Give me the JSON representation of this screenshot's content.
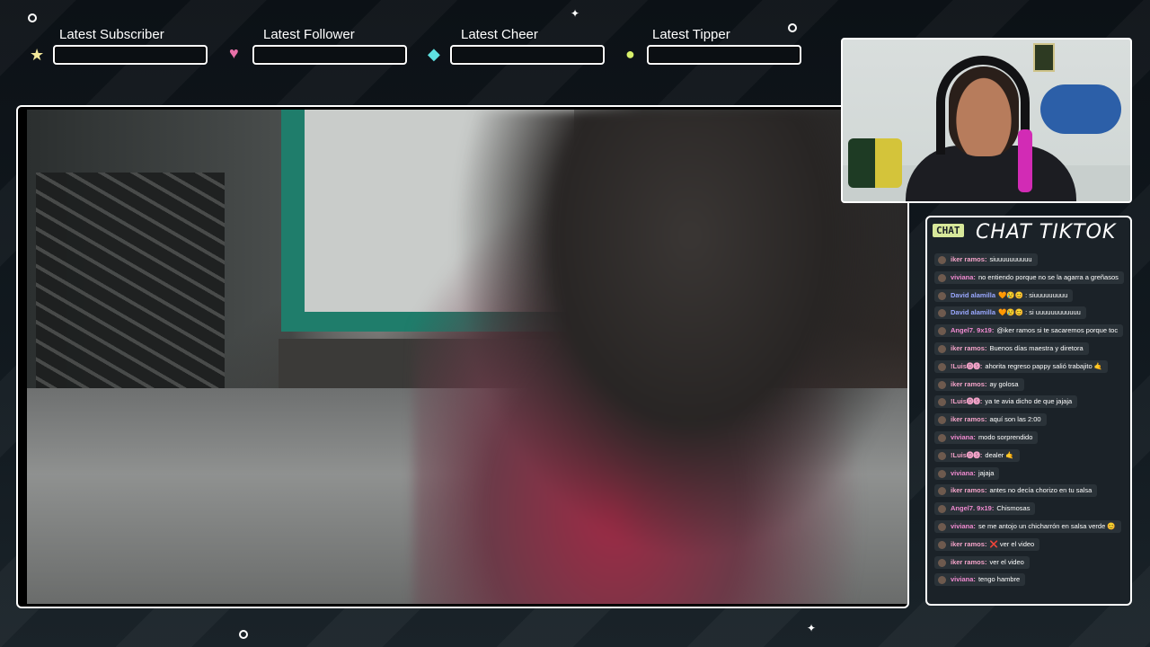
{
  "alerts": [
    {
      "title": "Latest Subscriber",
      "icon": "★",
      "icon_name": "star-icon",
      "color": "#f3e89a"
    },
    {
      "title": "Latest Follower",
      "icon": "♥",
      "icon_name": "heart-icon",
      "color": "#e870a8"
    },
    {
      "title": "Latest Cheer",
      "icon": "◆",
      "icon_name": "gem-icon",
      "color": "#5fe0e0"
    },
    {
      "title": "Latest Tipper",
      "icon": "●",
      "icon_name": "coin-icon",
      "color": "#d7ef6a"
    }
  ],
  "chat": {
    "tag": "CHAT",
    "title": "CHAT TIKTOK",
    "messages": [
      {
        "user": "iker ramos:",
        "text": "siuuuuuuuuuu",
        "color": "#f3a2c8"
      },
      {
        "user": "viviana:",
        "text": "no entiendo porque no se la agarra a greñasos",
        "color": "#f08ad0"
      },
      {
        "user": "David alamilla",
        "text": "🧡😢😊 : siuuuuuuuuu",
        "color": "#9aa8ff"
      },
      {
        "user": "David alamilla",
        "text": "🧡😢😊 : si uuuuuuuuuuuu",
        "color": "#9aa8ff"
      },
      {
        "user": "Angel7. 9x19:",
        "text": "@iker ramos si te sacaremos porque toc",
        "color": "#f08ad0"
      },
      {
        "user": "iker ramos:",
        "text": "Buenos días maestra y diretora",
        "color": "#f3a2c8"
      },
      {
        "user": "!Luis🅞🅢:",
        "text": "ahorita regreso pappy salió trabajito 🤙",
        "color": "#f3a2c8"
      },
      {
        "user": "iker ramos:",
        "text": "ay golosa",
        "color": "#f3a2c8"
      },
      {
        "user": "!Luis🅞🅢:",
        "text": "ya te avia dicho de que jajaja",
        "color": "#f3a2c8"
      },
      {
        "user": "iker ramos:",
        "text": "aquí son las 2:00",
        "color": "#f3a2c8"
      },
      {
        "user": "viviana:",
        "text": "modo sorprendido",
        "color": "#f08ad0"
      },
      {
        "user": "!Luis🅞🅢:",
        "text": "dealer 🤙",
        "color": "#f3a2c8"
      },
      {
        "user": "viviana:",
        "text": "jajaja",
        "color": "#f08ad0"
      },
      {
        "user": "iker ramos:",
        "text": "antes no decía chorizo en tu salsa",
        "color": "#f3a2c8"
      },
      {
        "user": "Angel7. 9x19:",
        "text": "Chismosas",
        "color": "#f08ad0"
      },
      {
        "user": "viviana:",
        "text": "se me antojo un chicharrón en salsa verde 😊",
        "color": "#f08ad0"
      },
      {
        "user": "iker ramos:",
        "text": "❌ ver el video",
        "color": "#f3a2c8"
      },
      {
        "user": "iker ramos:",
        "text": "ver el video",
        "color": "#f3a2c8"
      },
      {
        "user": "viviana:",
        "text": "tengo hambre",
        "color": "#f08ad0"
      }
    ]
  }
}
